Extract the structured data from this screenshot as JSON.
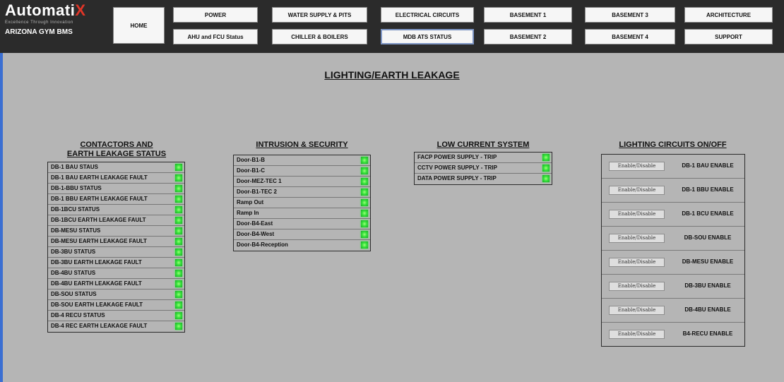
{
  "header": {
    "brand_main": "Automati",
    "brand_x": "X",
    "tagline": "Excellence Through Innovation",
    "site_name": "ARIZONA GYM BMS",
    "nav": [
      {
        "label": "HOME",
        "key": "home"
      },
      {
        "label": "POWER",
        "key": "power"
      },
      {
        "label": "AHU and FCU Status",
        "key": "ahu"
      },
      {
        "label": "WATER SUPPLY & PITS",
        "key": "water"
      },
      {
        "label": "CHILLER & BOILERS",
        "key": "chiller"
      },
      {
        "label": "ELECTRICAL CIRCUITS",
        "key": "electrical"
      },
      {
        "label": "MDB ATS STATUS",
        "key": "mdb"
      },
      {
        "label": "BASEMENT 1",
        "key": "b1"
      },
      {
        "label": "BASEMENT 2",
        "key": "b2"
      },
      {
        "label": "BASEMENT 3",
        "key": "b3"
      },
      {
        "label": "BASEMENT 4",
        "key": "b4"
      },
      {
        "label": "ARCHITECTURE",
        "key": "arch"
      },
      {
        "label": "SUPPORT",
        "key": "support"
      }
    ]
  },
  "page_title": "LIGHTING/EARTH LEAKAGE",
  "contactors": {
    "title_line1": "CONTACTORS AND",
    "title_line2": "EARTH LEAKAGE STATUS",
    "items": [
      "DB-1 BAU STAUS",
      "DB-1 BAU EARTH LEAKAGE FAULT",
      "DB-1-BBU STATUS",
      "DB-1 BBU EARTH LEAKAGE FAULT",
      "DB-1BCU STATUS",
      "DB-1BCU EARTH LEAKAGE FAULT",
      "DB-MESU STATUS",
      "DB-MESU EARTH LEAKAGE FAULT",
      "DB-3BU STATUS",
      "DB-3BU EARTH LEAKAGE FAULT",
      "DB-4BU STATUS",
      "DB-4BU EARTH LEAKAGE FAULT",
      "DB-SOU STATUS",
      "DB-SOU EARTH LEAKAGE FAULT",
      "DB-4 RECU STATUS",
      "DB-4 REC EARTH LEAKAGE FAULT"
    ]
  },
  "intrusion": {
    "title": "INTRUSION & SECURITY",
    "items": [
      "Door-B1-B",
      "Door-B1-C",
      "Door-MEZ-TEC 1",
      "Door-B1-TEC 2",
      "Ramp Out",
      "Ramp In",
      "Door-B4-East",
      "Door-B4-West",
      "Door-B4-Reception"
    ]
  },
  "low_current": {
    "title": "LOW CURRENT SYSTEM",
    "items": [
      "FACP POWER SUPPLY - TRIP",
      "CCTV POWER SUPPLY - TRIP",
      "DATA POWER SUPPLY - TRIP"
    ]
  },
  "lighting": {
    "title": "LIGHTING CIRCUITS ON/OFF",
    "button_label": "Enable/Disable",
    "items": [
      "DB-1 BAU ENABLE",
      "DB-1 BBU ENABLE",
      "DB-1 BCU ENABLE",
      "DB-SOU ENABLE",
      "DB-MESU ENABLE",
      "DB-3BU ENABLE",
      "DB-4BU ENABLE",
      "B4-RECU ENABLE"
    ]
  },
  "colors": {
    "header_bg": "#2b2b2b",
    "brand_accent": "#e03527",
    "page_bg": "#b5b5b5",
    "status_on": "#36e23b",
    "left_edge": "#3b6fd2"
  }
}
